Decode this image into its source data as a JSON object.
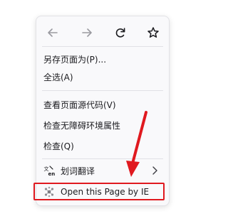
{
  "nav": {
    "back_icon": "arrow-left-icon",
    "forward_icon": "arrow-right-icon",
    "reload_icon": "reload-icon",
    "bookmark_icon": "star-icon"
  },
  "menu": {
    "save_page": "另存页面为(P)...",
    "select_all": "全选(A)",
    "view_source": "查看页面源代码(V)",
    "accessibility": "检查无障碍环境属性",
    "inspect": "检查(Q)",
    "translate": "划词翻译",
    "open_ie": "Open this Page by IE"
  },
  "colors": {
    "highlight": "#e0191f",
    "arrow": "#e0191f"
  }
}
